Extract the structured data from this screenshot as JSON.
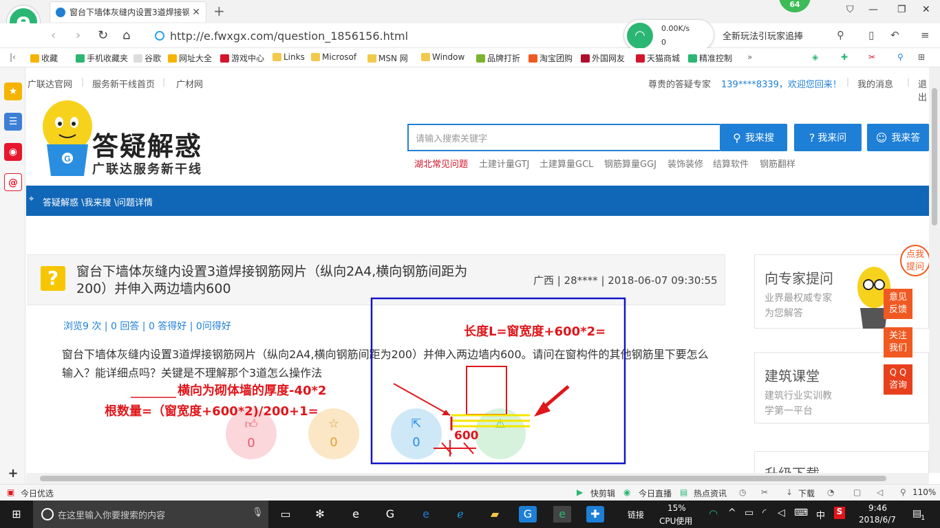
{
  "browser": {
    "tab_title": "窗台下墙体灰缝内设置3道焊接钢",
    "new_tab": "+",
    "badge_count": "64",
    "url": "http://e.fwxgx.com/question_1856156.html",
    "net_speed": "0.00K/s",
    "net_count": "0",
    "promo_text": "全新玩法引玩家追捧",
    "bookmarks": [
      "收藏",
      "手机收藏夹",
      "谷歌",
      "网址大全",
      "游戏中心",
      "Links",
      "Microsof",
      "MSN 网",
      "Window",
      "品牌打折",
      "淘宝团购",
      "外国网友",
      "天猫商城",
      "精准控制"
    ],
    "more": "»"
  },
  "site": {
    "top_links": [
      "广联达官网",
      "服务新干线首页",
      "广材网"
    ],
    "greeting": "尊贵的答疑专家",
    "user_phone": "139****8339，欢迎您回来！",
    "my_messages": "我的消息",
    "logout": "退出",
    "brand": "答疑解惑",
    "brand_sub": "广联达服务新干线",
    "search_placeholder": "请输入搜索关键字",
    "btn_search": "我来搜",
    "btn_ask": "我来问",
    "btn_answer": "我来答",
    "hot_tags": [
      "湖北常见问题",
      "土建计量GTJ",
      "土建算量GCL",
      "钢筋算量GGJ",
      "装饰装修",
      "结算软件",
      "钢筋翻样"
    ],
    "breadcrumb": "答疑解惑 \\我来搜 \\问题详情"
  },
  "question": {
    "title": "窗台下墙体灰缝内设置3道焊接钢筋网片（纵向2A4,横向钢筋间距为200）并伸入两边墙内600",
    "meta": "广西 | 28**** | 2018-06-07 09:30:55",
    "stats": "浏览9 次 | 0 回答 | 0 答得好 | 0问得好",
    "body": "窗台下墙体灰缝内设置3道焊接钢筋网片（纵向2A4,横向钢筋间距为200）并伸入两边墙内600。请问在窗构件的其他钢筋里下要怎么输入？能详细点吗？关键是不理解那个3道怎么操作法",
    "likes": "0",
    "stars": "0",
    "shares": "0"
  },
  "right_panel": {
    "expert_title": "向专家提问",
    "expert_desc1": "业界最权威专家",
    "expert_desc2": "为您解答",
    "class_title": "建筑课堂",
    "class_desc1": "建筑行业实训教",
    "class_desc2": "学第一平台",
    "download_title": "升级下载",
    "bubble": "点我\n提问",
    "side_tabs": [
      "意见\n反馈",
      "关注\n我们",
      "Q Q\n咨询"
    ]
  },
  "annotation": {
    "length_formula": "长度L=窗宽度+600*2=",
    "transverse": "横向为砌体墙的厚度-40*2",
    "count_formula": "根数量=（窗宽度+600*2)/200+1=",
    "dim_600": "600"
  },
  "statusbar": {
    "left": "今日优选",
    "items": [
      "快剪辑",
      "今日直播",
      "热点资讯",
      "下载"
    ],
    "zoom": "110%"
  },
  "taskbar": {
    "search_placeholder": "在这里输入你要搜索的内容",
    "link_label": "链接",
    "cpu_pct": "15%",
    "cpu_label": "CPU使用",
    "ime": "中",
    "time": "9:46",
    "date": "2018/6/7",
    "notif": "1"
  },
  "colors": {
    "accent": "#1e7fd6",
    "nav": "#1066b7",
    "annotation_red": "#e0161b",
    "annotation_blue": "#1414c8",
    "highlight_yellow": "#f5e600"
  }
}
